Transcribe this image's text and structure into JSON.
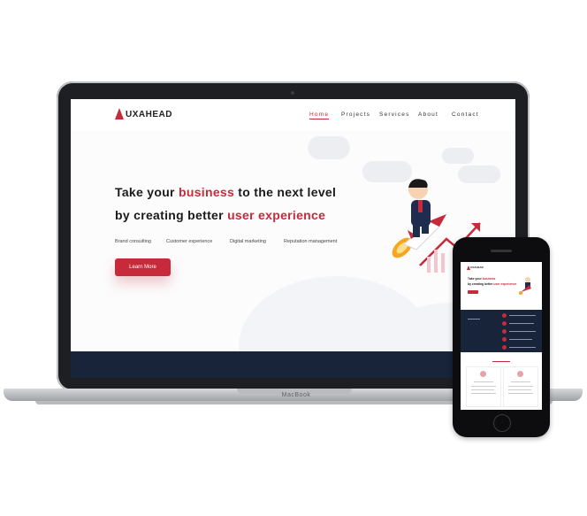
{
  "site": {
    "logo_text": "UXAHEAD",
    "nav": [
      "Home",
      "Projects",
      "Services",
      "About",
      "Contact"
    ],
    "nav_active": "Home",
    "headline_line1_pre": "Take your ",
    "headline_line1_accent": "business",
    "headline_line1_post": " to the next level",
    "headline_line2_pre": "by creating better ",
    "headline_line2_accent": "user experience",
    "tags": [
      "Brand consulting",
      "Customer experience",
      "Digital marketing",
      "Reputation management"
    ],
    "cta_label": "Learn More"
  },
  "device": {
    "laptop_label": "MacBook"
  },
  "colors": {
    "accent": "#c62a3b",
    "navy": "#17243a",
    "text": "#1a1a1a"
  },
  "icons": [
    "rocket-character-illustration",
    "growth-arrow-icon",
    "cloud-icon"
  ]
}
